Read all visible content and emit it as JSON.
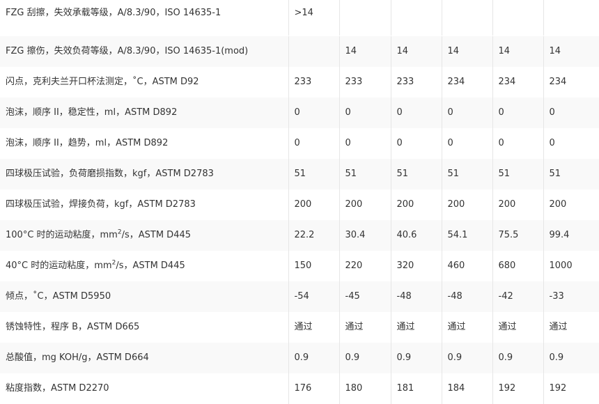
{
  "rows": [
    {
      "label": "FZG 刮擦，失效承载等级，A/8.3/90，ISO 14635-1",
      "values": [
        ">14",
        "",
        "",
        "",
        "",
        ""
      ]
    },
    {
      "label": "FZG 擦伤，失效负荷等级，A/8.3/90，ISO 14635-1(mod)",
      "values": [
        "",
        "14",
        "14",
        "14",
        "14",
        "14"
      ]
    },
    {
      "label": "闪点，克利夫兰开口杯法测定，˚C，ASTM D92",
      "values": [
        "233",
        "233",
        "233",
        "234",
        "234",
        "234"
      ]
    },
    {
      "label": "泡沫，顺序 II，稳定性，ml，ASTM D892",
      "values": [
        "0",
        "0",
        "0",
        "0",
        "0",
        "0"
      ]
    },
    {
      "label": "泡沫，顺序 II，趋势，ml，ASTM D892",
      "values": [
        "0",
        "0",
        "0",
        "0",
        "0",
        "0"
      ]
    },
    {
      "label": "四球极压试验，负荷磨损指数，kgf，ASTM D2783",
      "values": [
        "51",
        "51",
        "51",
        "51",
        "51",
        "51"
      ]
    },
    {
      "label": "四球极压试验，焊接负荷，kgf，ASTM D2783",
      "values": [
        "200",
        "200",
        "200",
        "200",
        "200",
        "200"
      ]
    },
    {
      "label_pre": "100°C 时的运动粘度，mm",
      "label_sup": "2",
      "label_post": "/s，ASTM D445",
      "values": [
        "22.2",
        "30.4",
        "40.6",
        "54.1",
        "75.5",
        "99.4"
      ]
    },
    {
      "label_pre": "40°C 时的运动粘度，mm",
      "label_sup": "2",
      "label_post": "/s，ASTM D445",
      "values": [
        "150",
        "220",
        "320",
        "460",
        "680",
        "1000"
      ]
    },
    {
      "label": "倾点，˚C，ASTM D5950",
      "values": [
        "-54",
        "-45",
        "-48",
        "-48",
        "-42",
        "-33"
      ]
    },
    {
      "label": "锈蚀特性，程序 B，ASTM D665",
      "values": [
        "通过",
        "通过",
        "通过",
        "通过",
        "通过",
        "通过"
      ]
    },
    {
      "label": "总酸值，mg KOH/g，ASTM D664",
      "values": [
        "0.9",
        "0.9",
        "0.9",
        "0.9",
        "0.9",
        "0.9"
      ]
    },
    {
      "label": "粘度指数，ASTM D2270",
      "values": [
        "176",
        "180",
        "181",
        "184",
        "192",
        "192"
      ]
    }
  ]
}
